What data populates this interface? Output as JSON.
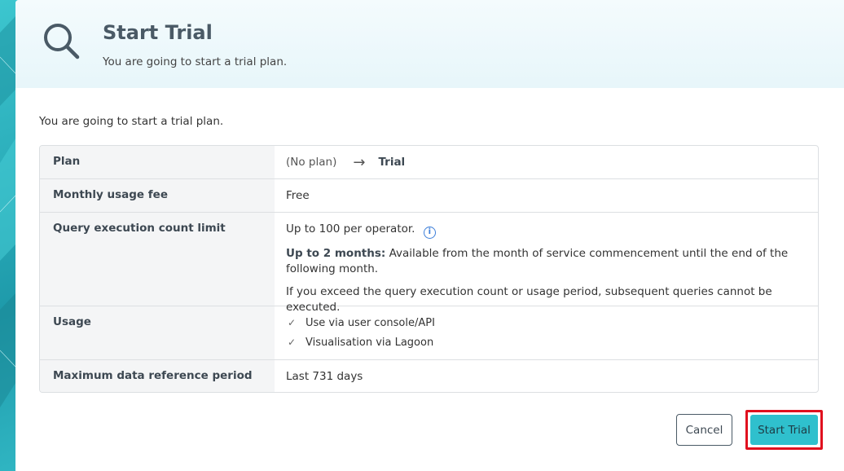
{
  "header": {
    "title": "Start Trial",
    "subtitle": "You are going to start a trial plan.",
    "icon": "search-icon"
  },
  "intro": "You are going to start a trial plan.",
  "table": {
    "plan": {
      "label": "Plan",
      "from": "(No plan)",
      "to": "Trial"
    },
    "fee": {
      "label": "Monthly usage fee",
      "value": "Free"
    },
    "query": {
      "label": "Query execution count limit",
      "limit": "Up to 100 per operator.",
      "period_bold": "Up to 2 months:",
      "period_text": " Available from the month of service commencement until the end of the following month.",
      "note": "If you exceed the query execution count or usage period, subsequent queries cannot be executed."
    },
    "usage": {
      "label": "Usage",
      "items": [
        "Use via user console/API",
        "Visualisation via Lagoon"
      ]
    },
    "period": {
      "label": "Maximum data reference period",
      "value": "Last 731 days"
    }
  },
  "buttons": {
    "cancel": "Cancel",
    "start": "Start Trial"
  },
  "colors": {
    "accent": "#2fc0cd",
    "highlight": "#e0101e",
    "heading": "#4a5a66"
  }
}
